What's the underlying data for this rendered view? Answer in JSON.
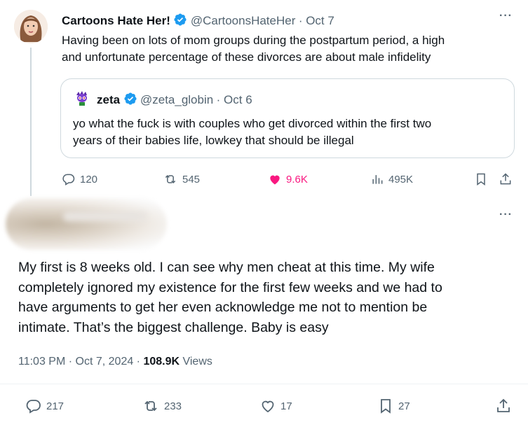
{
  "quoted_parent": {
    "author_name": "Cartoons Hate Her!",
    "handle": "@CartoonsHateHer",
    "date": "· Oct 7",
    "text_line1": "Having been on lots of mom groups during the postpartum period, a high",
    "text_line2": "and unfortunate percentage of these divorces are about male infidelity",
    "more": "···",
    "quote": {
      "author_name": "zeta",
      "handle": "@zeta_globin",
      "date": "· Oct 6",
      "text_line1": "yo what the fuck is with couples who get divorced within the first  two",
      "text_line2": "years of their babies life, lowkey that should be illegal"
    },
    "actions": {
      "replies": "120",
      "reposts": "545",
      "likes": "9.6K",
      "views": "495K"
    },
    "like_color": "#f91880"
  },
  "main_tweet": {
    "more": "···",
    "text_lines": [
      "My first is 8 weeks old. I can see why men cheat at this time. My wife",
      "completely ignored my existence for the first few weeks and we had to",
      "have arguments to get her even acknowledge me not to mention be",
      "intimate. That’s the biggest challenge. Baby is easy"
    ],
    "time": "11:03 PM · Oct 7, 2024 · ",
    "views_count": "108.9K",
    "views_label": " Views",
    "actions": {
      "replies": "217",
      "reposts": "233",
      "likes": "17",
      "bookmarks": "27"
    }
  },
  "colors": {
    "verified": "#1d9bf0",
    "muted": "#536471",
    "text": "#0f1419"
  }
}
